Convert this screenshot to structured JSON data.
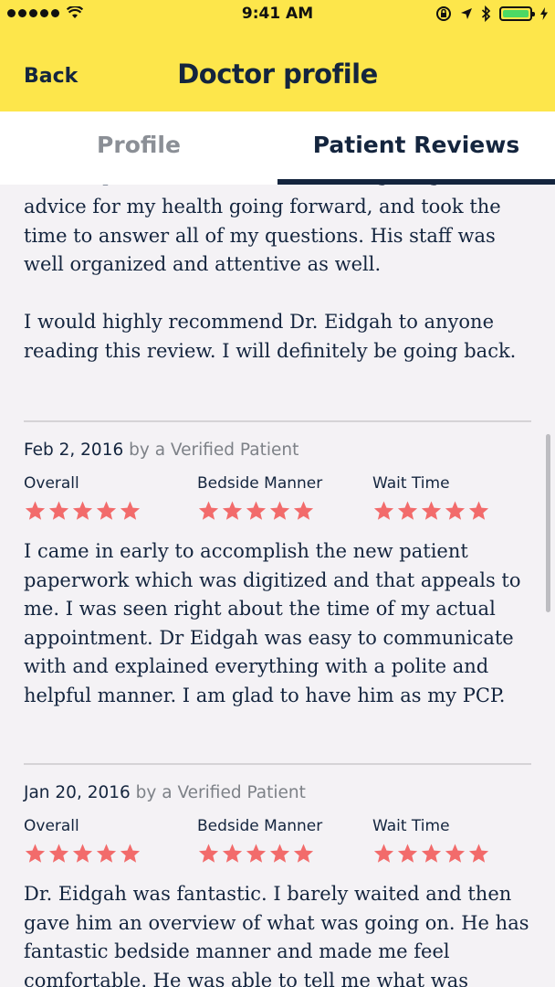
{
  "status_bar": {
    "time": "9:41 AM"
  },
  "nav": {
    "back_label": "Back",
    "title": "Doctor profile"
  },
  "tabs": [
    {
      "label": "Profile"
    },
    {
      "label": "Patient Reviews"
    }
  ],
  "colors": {
    "accent_yellow": "#fde64b",
    "navy": "#14253e",
    "star": "#f26b6b"
  },
  "reviews": [
    {
      "text_cut_line": "his exceptional bedside manner. He gave great",
      "text_p1": "advice for my health going forward, and took the time to answer all of my questions. His staff was well organized and attentive as well.",
      "text_p2": "I would highly recommend Dr. Eidgah to anyone reading this review. I will definitely be going back."
    },
    {
      "date": "Feb 2, 2016",
      "by": "by a Verified Patient",
      "ratings": [
        {
          "label": "Overall",
          "stars": 5
        },
        {
          "label": "Bedside Manner",
          "stars": 5
        },
        {
          "label": "Wait Time",
          "stars": 5
        }
      ],
      "text": "I came in early to accomplish the new patient paperwork which was digitized and that appeals to me. I was seen right about the time of my actual appointment. Dr Eidgah was easy to communicate with and explained everything with a polite and helpful manner. I am glad to have him as my PCP."
    },
    {
      "date": "Jan 20, 2016",
      "by": "by a Verified Patient",
      "ratings": [
        {
          "label": "Overall",
          "stars": 5
        },
        {
          "label": "Bedside Manner",
          "stars": 5
        },
        {
          "label": "Wait Time",
          "stars": 5
        }
      ],
      "text": "Dr. Eidgah was fantastic. I barely waited and then gave him an overview of what was going on. He has fantastic bedside manner and made me feel comfortable. He was able to tell me what was"
    }
  ]
}
